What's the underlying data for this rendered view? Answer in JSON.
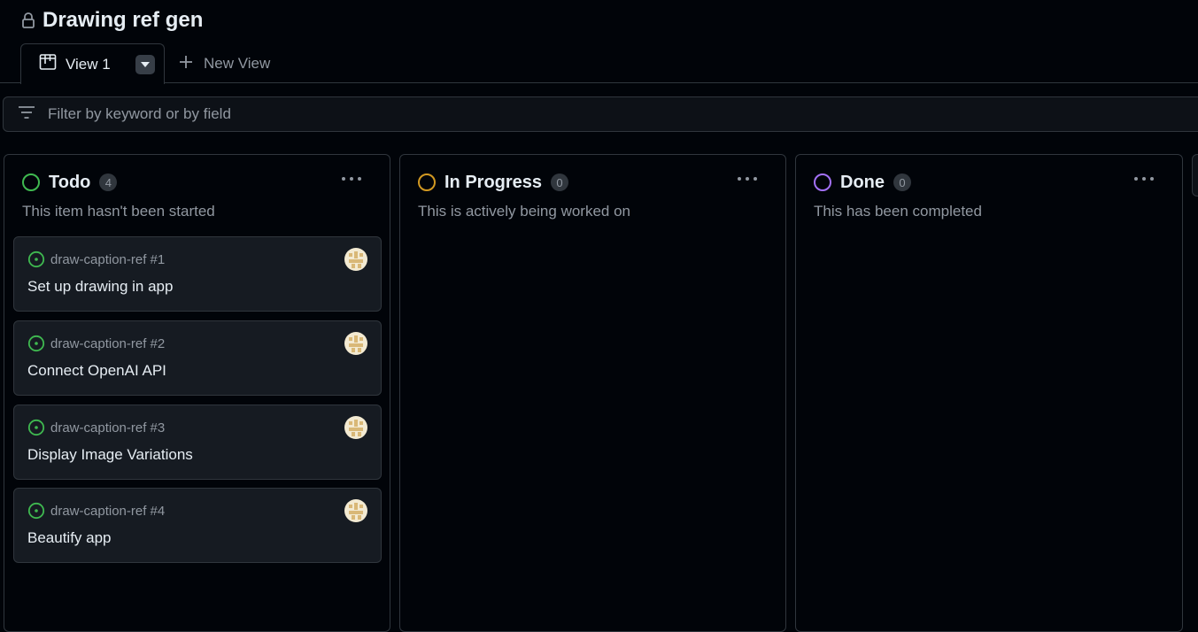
{
  "project": {
    "title": "Drawing ref gen"
  },
  "tabs": {
    "active_label": "View 1",
    "new_view_label": "New View"
  },
  "filter": {
    "placeholder": "Filter by keyword or by field"
  },
  "columns": [
    {
      "title": "Todo",
      "count": "4",
      "description": "This item hasn't been started",
      "status_color": "#3fb950",
      "cards": [
        {
          "ref": "draw-caption-ref #1",
          "title": "Set up drawing in app"
        },
        {
          "ref": "draw-caption-ref #2",
          "title": "Connect OpenAI API"
        },
        {
          "ref": "draw-caption-ref #3",
          "title": "Display Image Variations"
        },
        {
          "ref": "draw-caption-ref #4",
          "title": "Beautify app"
        }
      ]
    },
    {
      "title": "In Progress",
      "count": "0",
      "description": "This is actively being worked on",
      "status_color": "#d29922",
      "cards": []
    },
    {
      "title": "Done",
      "count": "0",
      "description": "This has been completed",
      "status_color": "#a371f7",
      "cards": []
    }
  ],
  "icons": {
    "lock": "lock-icon",
    "board": "board-view-icon",
    "dropdown": "triangle-down-icon",
    "plus": "plus-icon",
    "filter": "filter-icon",
    "more": "kebab-horizontal-icon",
    "issue_open": "issue-opened-icon",
    "avatar": "identicon-avatar"
  },
  "colors": {
    "background": "#010409",
    "card": "#161b22",
    "border": "#30363d",
    "open_issue": "#3fb950",
    "avatar": "#e0c890"
  }
}
